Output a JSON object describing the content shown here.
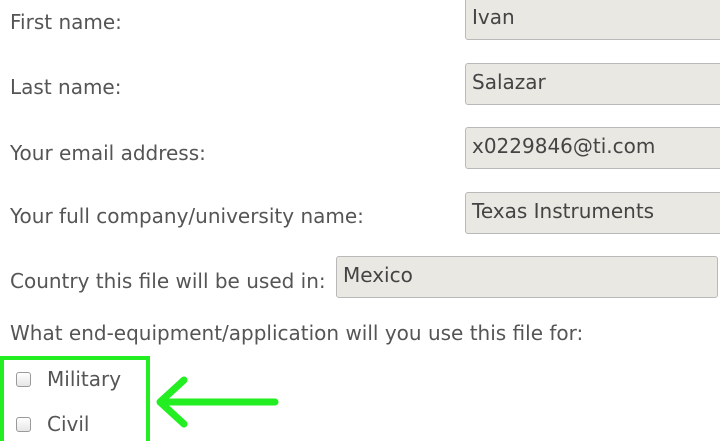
{
  "form": {
    "first_name": {
      "label": "First name:",
      "value": "Ivan"
    },
    "last_name": {
      "label": "Last name:",
      "value": "Salazar"
    },
    "email": {
      "label": "Your email address:",
      "value": "x0229846@ti.com"
    },
    "company": {
      "label": "Your full company/university name:",
      "value": "Texas Instruments"
    },
    "country": {
      "label": "Country this file will be used in:",
      "value": "Mexico"
    },
    "end_equipment": {
      "question": "What end-equipment/application will you use this file for:",
      "options": [
        {
          "label": "Military",
          "checked": false
        },
        {
          "label": "Civil",
          "checked": false
        }
      ]
    }
  },
  "annotation": {
    "color": "#22ee22",
    "icon": "arrow-left-icon"
  }
}
